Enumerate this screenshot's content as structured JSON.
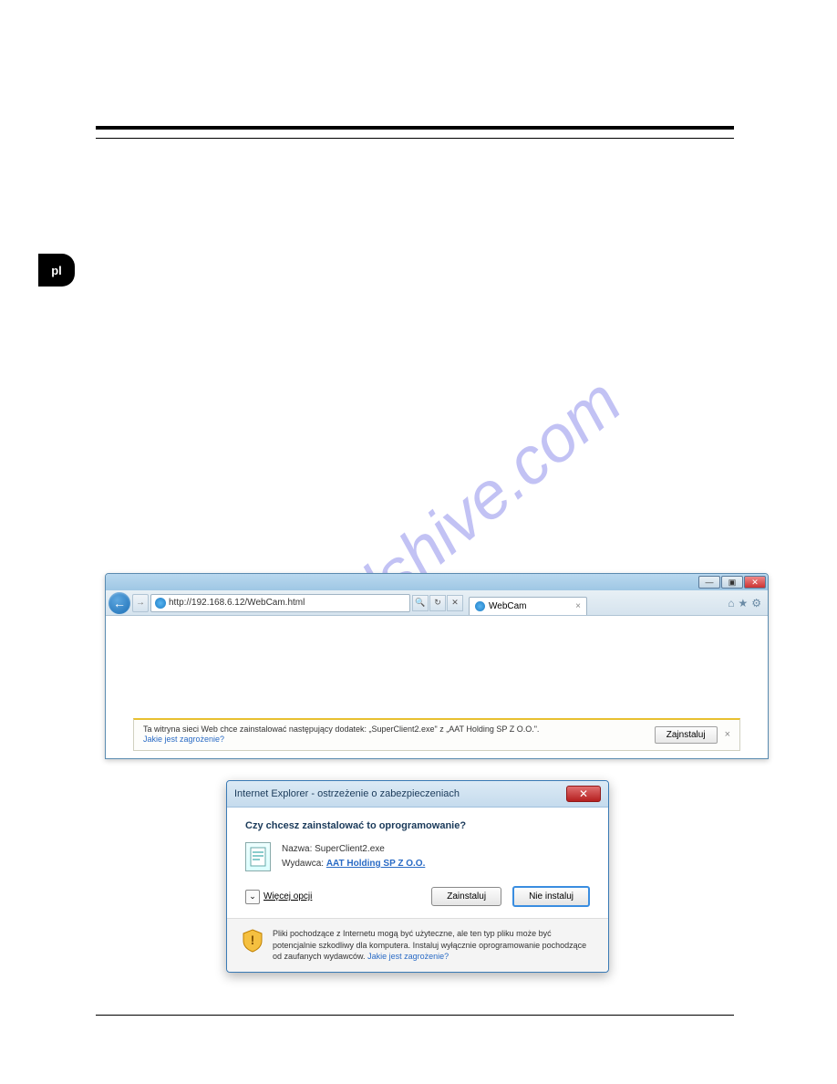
{
  "page_tab": "pl",
  "watermark_text": "manualshive.com",
  "browser": {
    "url": "http://192.168.6.12/WebCam.html",
    "tab_title": "WebCam",
    "notif_text": "Ta witryna sieci Web chce zainstalować następujący dodatek: „SuperClient2.exe\" z „AAT Holding  SP Z O.O.\".",
    "notif_link": "Jakie jest zagrożenie?",
    "notif_button": "Zajnstaluj"
  },
  "dialog": {
    "title": "Internet Explorer - ostrzeżenie o zabezpieczeniach",
    "question": "Czy chcesz zainstalować to oprogramowanie?",
    "name_label": "Nazwa:",
    "name_value": "SuperClient2.exe",
    "publisher_label": "Wydawca:",
    "publisher_value": "AAT Holding  SP Z O.O.",
    "more_options": "Więcej opcji",
    "install_btn": "Zainstaluj",
    "dont_install_btn": "Nie instaluj",
    "footer_text": "Pliki pochodzące z Internetu mogą być użyteczne, ale ten typ pliku może być potencjalnie szkodliwy dla komputera. Instaluj wyłącznie oprogramowanie pochodzące od zaufanych wydawców.",
    "footer_link": "Jakie jest zagrożenie?"
  }
}
